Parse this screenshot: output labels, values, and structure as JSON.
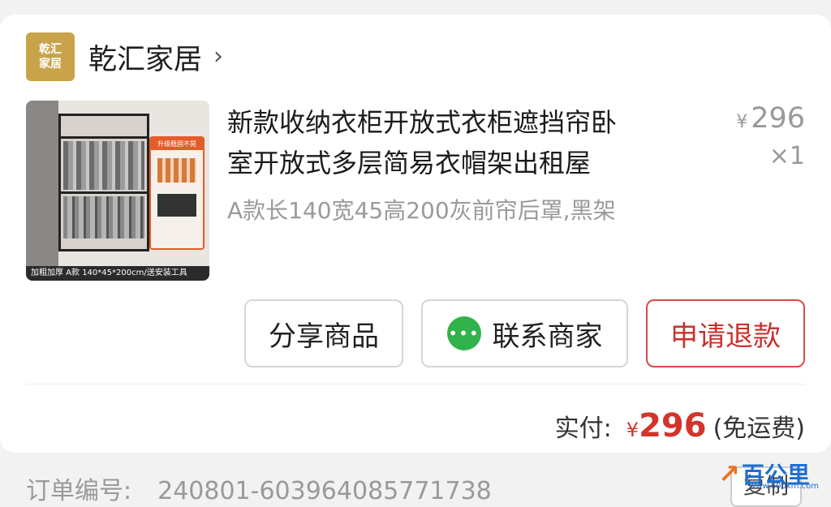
{
  "shop": {
    "logo_line1": "乾汇",
    "logo_line2": "家居",
    "name": "乾汇家居",
    "chevron": "›"
  },
  "product": {
    "thumb_caption": "加粗加厚 A款  140*45*200cm/送安装工具",
    "thumb_tag": "升级稳固不晃",
    "title_line1": "新款收纳衣柜开放式衣柜遮挡帘卧",
    "title_line2": "室开放式多层简易衣帽架出租屋",
    "spec": "A款长140宽45高200灰前帘后罩,黑架",
    "currency": "¥",
    "price": "296",
    "quantity": "×1"
  },
  "actions": {
    "share": "分享商品",
    "contact": "联系商家",
    "refund": "申请退款"
  },
  "payment": {
    "label": "实付:",
    "currency": "¥",
    "amount": "296",
    "note": "(免运费)"
  },
  "order": {
    "label": "订单编号:",
    "number": "240801-603964085771738",
    "copy_label": "复制"
  },
  "watermark": {
    "text": "百公里",
    "url": "www.600km.com"
  },
  "colors": {
    "accent_red": "#d3342c",
    "logo_gold": "#c9a34a",
    "wechat_green": "#2fb34a"
  }
}
